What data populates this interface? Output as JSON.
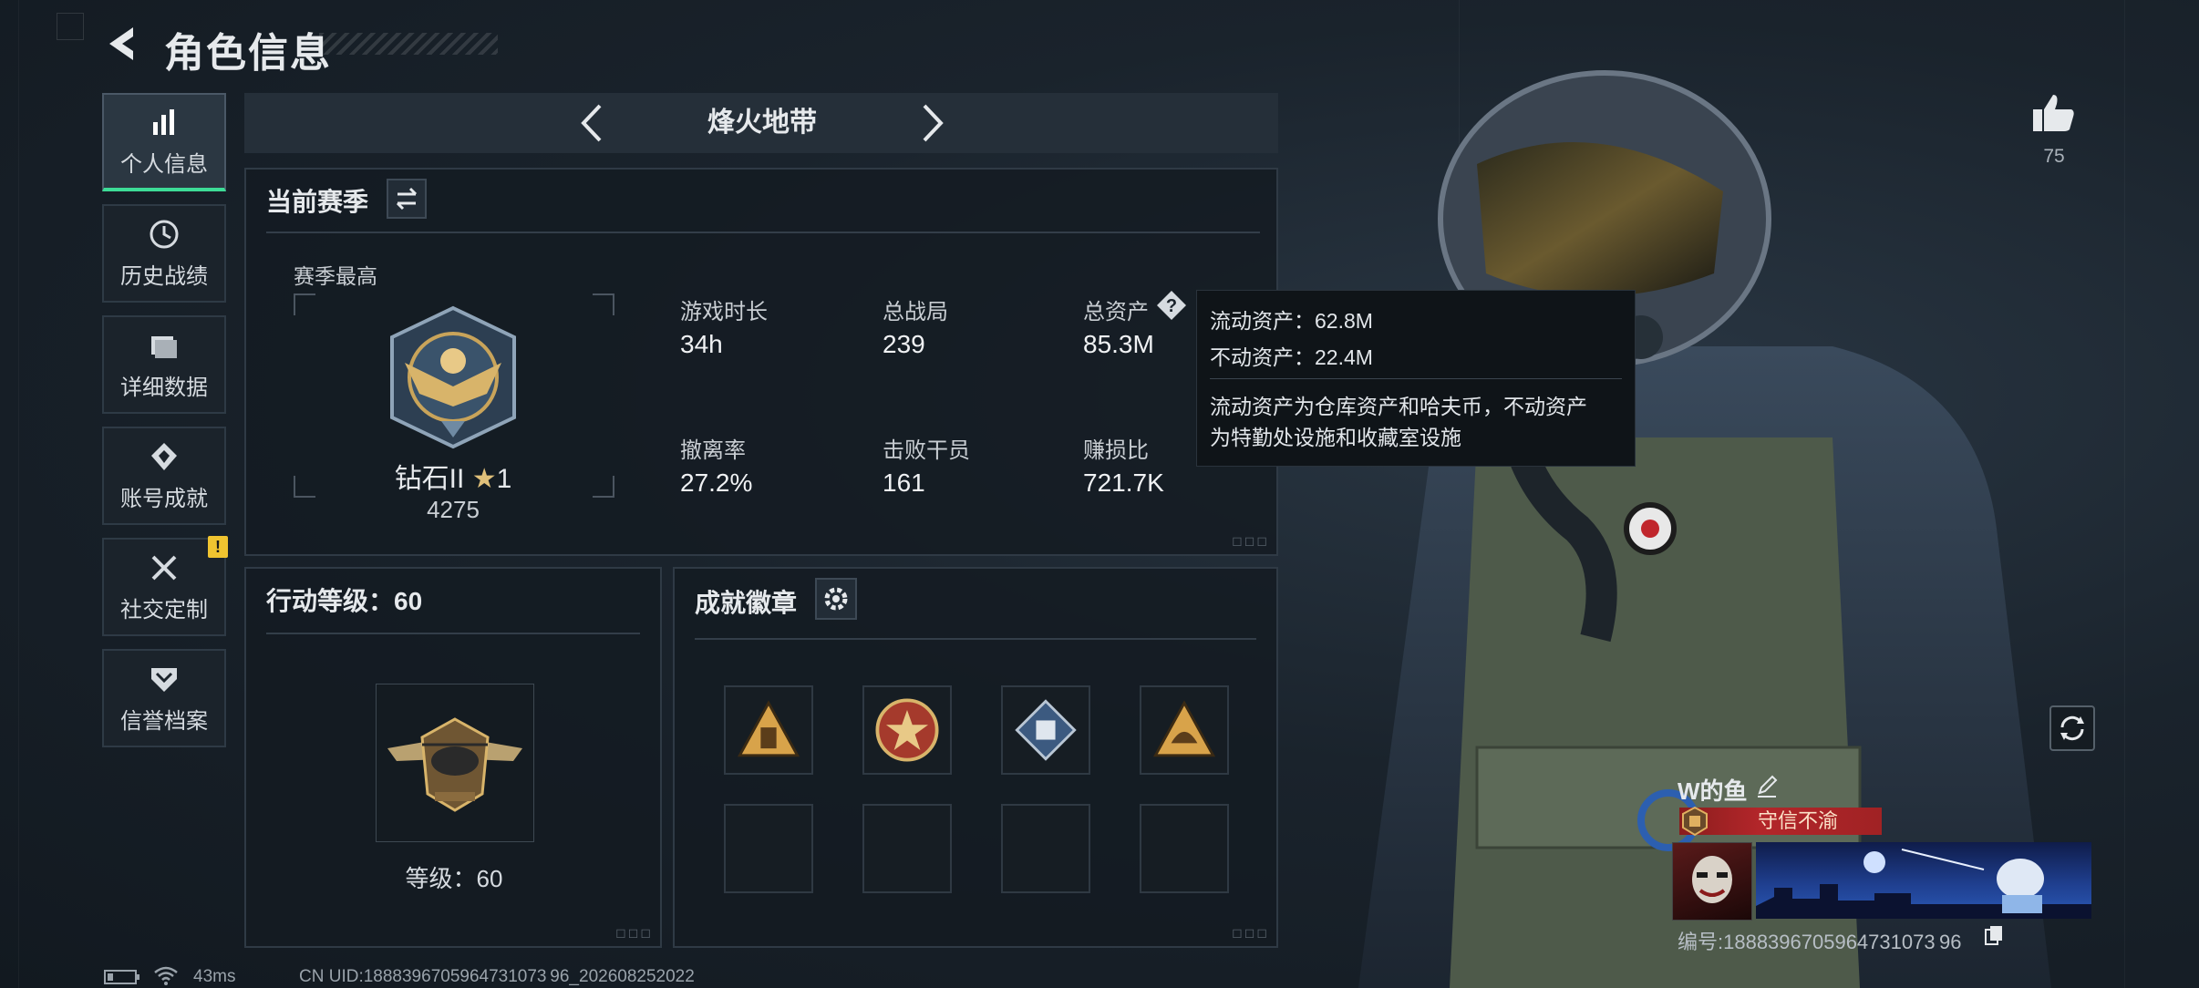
{
  "header": {
    "title": "角色信息"
  },
  "sidebar": {
    "items": [
      {
        "label": "个人信息",
        "icon": "bar-chart-icon",
        "active": true
      },
      {
        "label": "历史战绩",
        "icon": "history-clock-icon"
      },
      {
        "label": "详细数据",
        "icon": "folder-icon"
      },
      {
        "label": "账号成就",
        "icon": "achievement-icon"
      },
      {
        "label": "社交定制",
        "icon": "tools-icon",
        "badge": "!"
      },
      {
        "label": "信誉档案",
        "icon": "shield-chevron-icon"
      }
    ]
  },
  "mode": {
    "title": "烽火地带"
  },
  "season": {
    "title": "当前赛季",
    "best_label": "赛季最高",
    "rank_name": "钻石II",
    "rank_stars": "1",
    "rank_score": "4275",
    "stats": [
      {
        "label": "游戏时长",
        "value": "34h"
      },
      {
        "label": "总战局",
        "value": "239"
      },
      {
        "label": "总资产",
        "value": "85.3M"
      },
      {
        "label": "撤离率",
        "value": "27.2%"
      },
      {
        "label": "击败干员",
        "value": "161"
      },
      {
        "label": "赚损比",
        "value": "721.7K"
      }
    ]
  },
  "tooltip": {
    "liquid": "流动资产：62.8M",
    "fixed": "不动资产：22.4M",
    "desc1": "流动资产为仓库资产和哈夫币，不动资产",
    "desc2": "为特勤处设施和收藏室设施"
  },
  "level": {
    "title": "行动等级：60",
    "caption": "等级：60"
  },
  "achievements": {
    "title": "成就徽章"
  },
  "likes": {
    "count": "75"
  },
  "player": {
    "name": "W的鱼",
    "title_badge": "守信不渝",
    "id_text": "编号:1888396705964731073 96"
  },
  "status": {
    "ping": "43ms",
    "uid": "CN UID:1888396705964731073 96_202608252022"
  },
  "colors": {
    "accent": "#3ddc97",
    "warning": "#f0c430",
    "badge_red": "#b3262a"
  }
}
